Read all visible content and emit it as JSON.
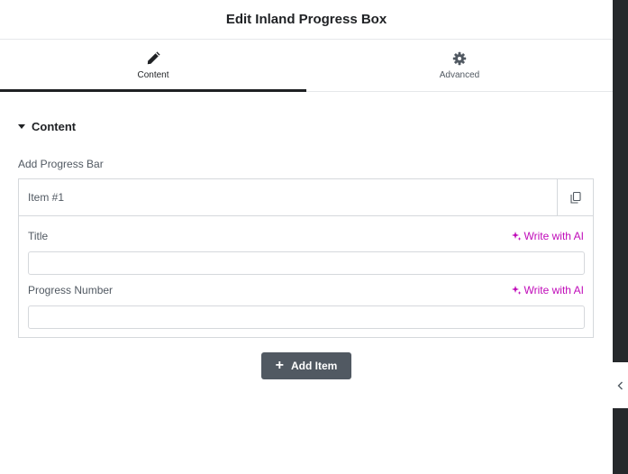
{
  "header": {
    "title": "Edit Inland Progress Box"
  },
  "tabs": [
    {
      "label": "Content",
      "icon": "pencil-icon",
      "active": true
    },
    {
      "label": "Advanced",
      "icon": "gear-icon",
      "active": false
    }
  ],
  "section": {
    "title": "Content",
    "expanded": true
  },
  "repeater": {
    "label": "Add Progress Bar",
    "items": [
      {
        "title": "Item #1",
        "fields": [
          {
            "label": "Title",
            "value": "",
            "ai_label": "Write with AI"
          },
          {
            "label": "Progress Number",
            "value": "",
            "ai_label": "Write with AI"
          }
        ]
      }
    ],
    "add_label": "Add Item"
  },
  "colors": {
    "ai_accent": "#c00bb9",
    "button_bg": "#515962",
    "sidebar": "#26292c"
  }
}
